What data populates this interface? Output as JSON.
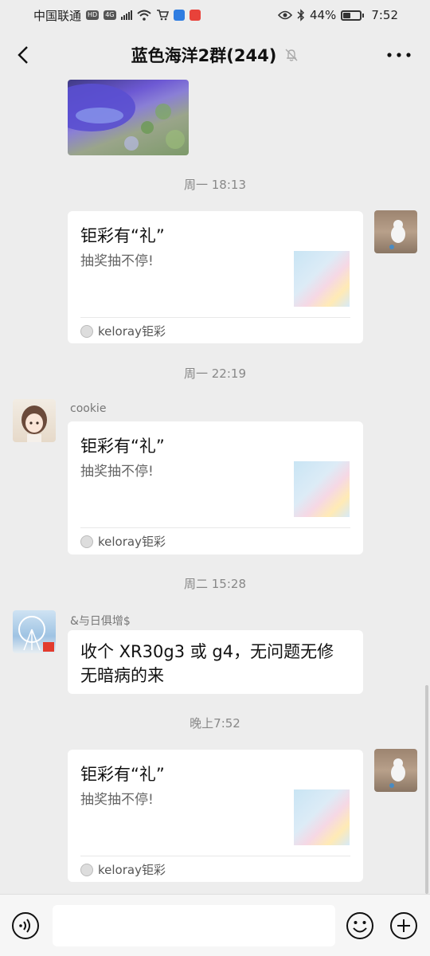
{
  "status_bar": {
    "carrier": "中国联通",
    "hd_badge": "HD",
    "network": "4G",
    "battery_percent": "44%",
    "battery_level": 0.44,
    "time": "7:52"
  },
  "header": {
    "title": "蓝色海洋2群(244)",
    "icons": [
      "back-arrow-icon",
      "mute-bell-icon",
      "more-icon"
    ]
  },
  "messages": [
    {
      "type": "image",
      "side": "left"
    },
    {
      "type": "timestamp",
      "text": "周一 18:13"
    },
    {
      "type": "card",
      "side": "right",
      "title": "钜彩有“礼”",
      "desc": "抽奖抽不停!",
      "source": "keloray钜彩"
    },
    {
      "type": "timestamp",
      "text": "周一 22:19"
    },
    {
      "type": "card",
      "side": "left",
      "sender": "cookie",
      "title": "钜彩有“礼”",
      "desc": "抽奖抽不停!",
      "source": "keloray钜彩"
    },
    {
      "type": "timestamp",
      "text": "周二 15:28"
    },
    {
      "type": "text",
      "side": "left",
      "sender": "&与日俱增$",
      "text": "收个 XR30g3 或 g4，无问题无修无暗病的来"
    },
    {
      "type": "timestamp",
      "text": "晚上7:52"
    },
    {
      "type": "card",
      "side": "right",
      "title": "钜彩有“礼”",
      "desc": "抽奖抽不停!",
      "source": "keloray钜彩"
    }
  ],
  "input_bar": {
    "placeholder": "",
    "icons": [
      "voice-icon",
      "emoji-icon",
      "plus-icon"
    ]
  }
}
